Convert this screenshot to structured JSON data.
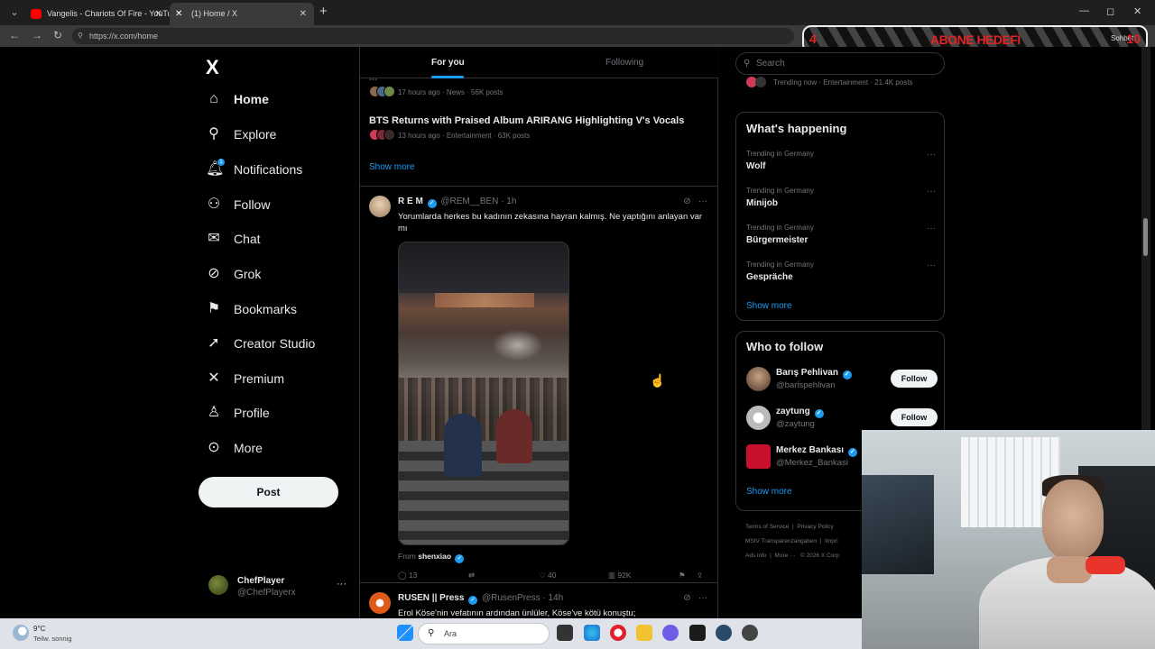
{
  "browser": {
    "tabs": [
      {
        "title": "Vangelis - Chariots Of Fire - YouTu",
        "favicon_color": "#ff0000"
      },
      {
        "title": "(1) Home / X",
        "favicon_color": "#ffffff"
      }
    ],
    "url": "https://x.com/home"
  },
  "overlay": {
    "banner_text": "ABONE HEDEFİ",
    "left_number": "4",
    "right_number": "10",
    "chat_label": "Sohbet"
  },
  "sidebar": {
    "logo": "X",
    "items": [
      {
        "label": "Home",
        "icon": "home-icon",
        "active": true
      },
      {
        "label": "Explore",
        "icon": "search-icon"
      },
      {
        "label": "Notifications",
        "icon": "bell-icon",
        "badge": "1"
      },
      {
        "label": "Follow",
        "icon": "person-add-icon"
      },
      {
        "label": "Chat",
        "icon": "mail-icon"
      },
      {
        "label": "Grok",
        "icon": "grok-icon"
      },
      {
        "label": "Bookmarks",
        "icon": "bookmark-icon"
      },
      {
        "label": "Creator Studio",
        "icon": "rocket-icon"
      },
      {
        "label": "Premium",
        "icon": "x-icon"
      },
      {
        "label": "Profile",
        "icon": "person-icon"
      },
      {
        "label": "More",
        "icon": "more-circle-icon"
      }
    ],
    "post_label": "Post",
    "user": {
      "name": "ChefPlayer",
      "handle": "@ChefPlayerx"
    }
  },
  "main": {
    "tabs": [
      {
        "label": "For you",
        "active": true
      },
      {
        "label": "Following",
        "active": false
      }
    ],
    "trends": [
      {
        "title": "...",
        "meta": "17 hours ago · News · 56K posts"
      },
      {
        "title": "BTS Returns with Praised Album ARIRANG Highlighting V's Vocals",
        "meta": "13 hours ago · Entertainment · 63K posts"
      }
    ],
    "show_more": "Show more",
    "tweets": [
      {
        "name": "R E M",
        "handle": "@REM__BEN",
        "time": "· 1h",
        "text": "Yorumlarda herkes bu kadının zekasına hayran kalmış. Ne yaptığını anlayan var mı",
        "from_label": "From",
        "from_user": "shenxiao",
        "replies": "13",
        "reposts": "",
        "likes": "40",
        "views": "92K"
      },
      {
        "name": "RUSEN || Press",
        "handle": "@RusenPress",
        "time": "· 14h",
        "text": "Erol Köse'nin vefatının ardından ünlüler, Köse've kötü konuştu;"
      }
    ]
  },
  "right": {
    "search_placeholder": "Search",
    "trending_now": "Trending now · Entertainment · 21.4K posts",
    "whats_happening": {
      "title": "What's happening",
      "items": [
        {
          "context": "Trending in Germany",
          "title": "Wolf"
        },
        {
          "context": "Trending in Germany",
          "title": "Minijob"
        },
        {
          "context": "Trending in Germany",
          "title": "Bürgermeister"
        },
        {
          "context": "Trending in Germany",
          "title": "Gespräche"
        }
      ],
      "show_more": "Show more"
    },
    "who_to_follow": {
      "title": "Who to follow",
      "items": [
        {
          "name": "Barış Pehlivan",
          "handle": "@barispehlivan",
          "follow": "Follow"
        },
        {
          "name": "zaytung",
          "handle": "@zaytung",
          "follow": "Follow"
        },
        {
          "name": "Merkez Bankası",
          "handle": "@Merkez_Bankasi",
          "follow": ""
        }
      ],
      "show_more": "Show more"
    },
    "footer": [
      "Terms of Service",
      "Privacy Policy",
      "MStV Transparenzangaben",
      "Impri",
      "Ads info",
      "More ···",
      "© 2026 X Corp"
    ]
  },
  "taskbar": {
    "temperature": "9°C",
    "weather": "Teilw. sonnig",
    "search_label": "Ara"
  },
  "colors": {
    "accent": "#1d9bf0",
    "background": "#000000",
    "text": "#e7e9ea",
    "muted": "#71767b"
  }
}
